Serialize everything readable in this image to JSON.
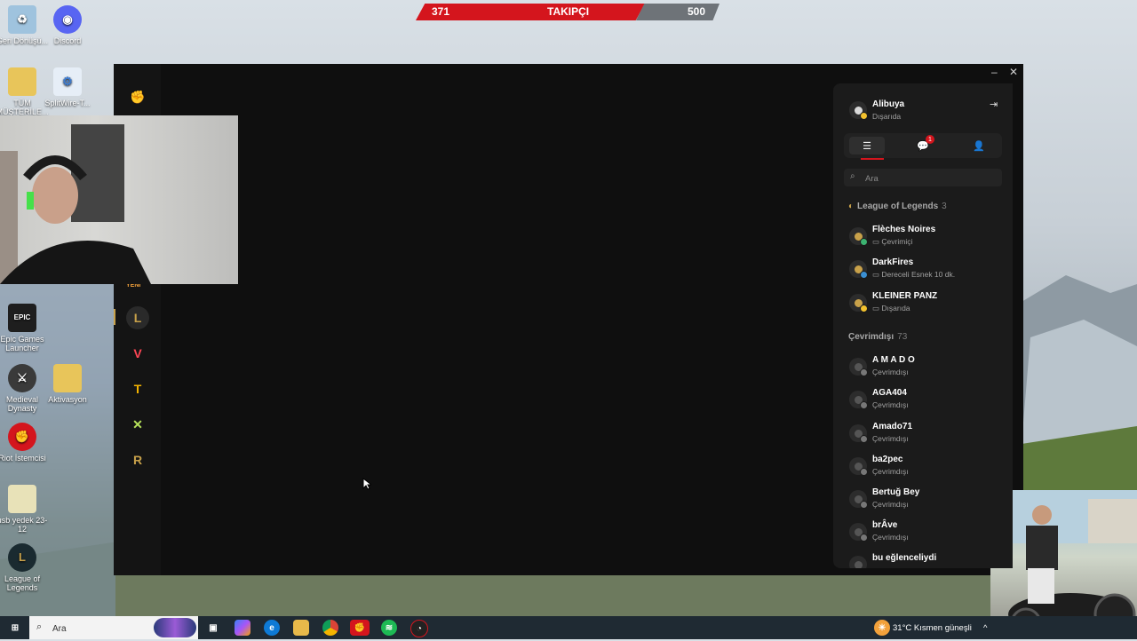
{
  "follow_bar": {
    "current": "371",
    "label": "TAKIPÇI",
    "goal": "500"
  },
  "desktop_icons": [
    {
      "label": "Geri Dönüşü...",
      "color": "#5aa2d6"
    },
    {
      "label": "Discord",
      "color": "#5865f2"
    },
    {
      "label": "TÜM MÜŞTERİLE...",
      "color": "#e8c55a"
    },
    {
      "label": "SplitWire-T...",
      "color": "#3b7bd1"
    },
    {
      "label": "Epic Games Launcher",
      "color": "#222222"
    },
    {
      "label": "Medieval Dynasty",
      "color": "#3a3a3a"
    },
    {
      "label": "Aktivasyon",
      "color": "#e8c55a"
    },
    {
      "label": "Riot İstemcisi",
      "color": "#d4151d"
    },
    {
      "label": "usb yedek 23-12",
      "color": "#e8c55a"
    },
    {
      "label": "League of Legends",
      "color": "#c8a14a"
    }
  ],
  "riot_client": {
    "new_badge": "YENİ",
    "window_controls": {
      "minimize": "–",
      "close": "✕"
    }
  },
  "friends_panel": {
    "user": {
      "name": "Alibuya",
      "status": "Dışarıda",
      "status_color": "#f2c12e"
    },
    "tabs_badge": "1",
    "search_placeholder": "Ara",
    "groups": [
      {
        "title": "League of Legends",
        "count": "3",
        "friends": [
          {
            "name": "Flèches Noires",
            "status": "Çevrimiçi",
            "status_color": "#3cb371"
          },
          {
            "name": "DarkFires",
            "status": "Dereceli Esnek 10 dk.",
            "status_color": "#3b8fd1"
          },
          {
            "name": "KLEINER PANZ",
            "status": "Dışarıda",
            "status_color": "#f2c12e"
          }
        ]
      },
      {
        "title": "Çevrimdışı",
        "count": "73",
        "friends": [
          {
            "name": "A M A D O",
            "status": "Çevrimdışı"
          },
          {
            "name": "AGA404",
            "status": "Çevrimdışı"
          },
          {
            "name": "Amado71",
            "status": "Çevrimdışı"
          },
          {
            "name": "ba2pec",
            "status": "Çevrimdışı"
          },
          {
            "name": "Bertuğ Bey",
            "status": "Çevrimdışı"
          },
          {
            "name": "brÂve",
            "status": "Çevrimdışı"
          },
          {
            "name": "bu eğlenceliydi",
            "status": ""
          }
        ]
      }
    ]
  },
  "taskbar": {
    "search_placeholder": "Ara",
    "weather": "31°C  Kısmen güneşli"
  },
  "colors": {
    "accent": "#d4151d",
    "panel": "#1b1b1b",
    "window": "#0f0f0f"
  }
}
